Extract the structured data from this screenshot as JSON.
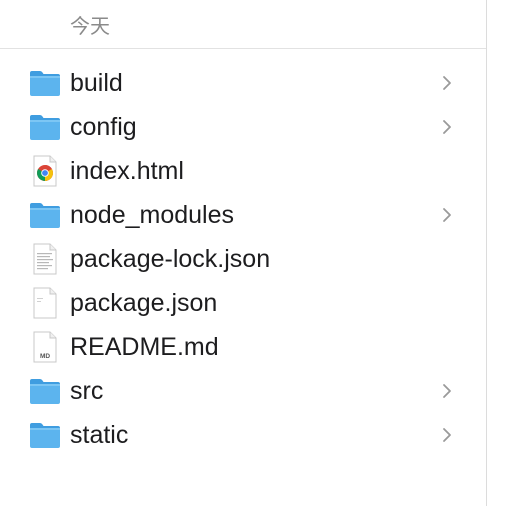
{
  "section": {
    "title": "今天"
  },
  "files": [
    {
      "name": "build",
      "kind": "folder",
      "expandable": true
    },
    {
      "name": "config",
      "kind": "folder",
      "expandable": true
    },
    {
      "name": "index.html",
      "kind": "chrome-html",
      "expandable": false
    },
    {
      "name": "node_modules",
      "kind": "folder",
      "expandable": true
    },
    {
      "name": "package-lock.json",
      "kind": "document",
      "expandable": false
    },
    {
      "name": "package.json",
      "kind": "document-blank",
      "expandable": false
    },
    {
      "name": "README.md",
      "kind": "markdown",
      "badge": "MD",
      "expandable": false
    },
    {
      "name": "src",
      "kind": "folder",
      "expandable": true
    },
    {
      "name": "static",
      "kind": "folder",
      "expandable": true
    }
  ],
  "colors": {
    "folder_body": "#5cb4ee",
    "folder_tab": "#3f9de0",
    "text": "#1d1d1f",
    "header_text": "#8a8a8a",
    "chevron": "#9a9a9a"
  }
}
